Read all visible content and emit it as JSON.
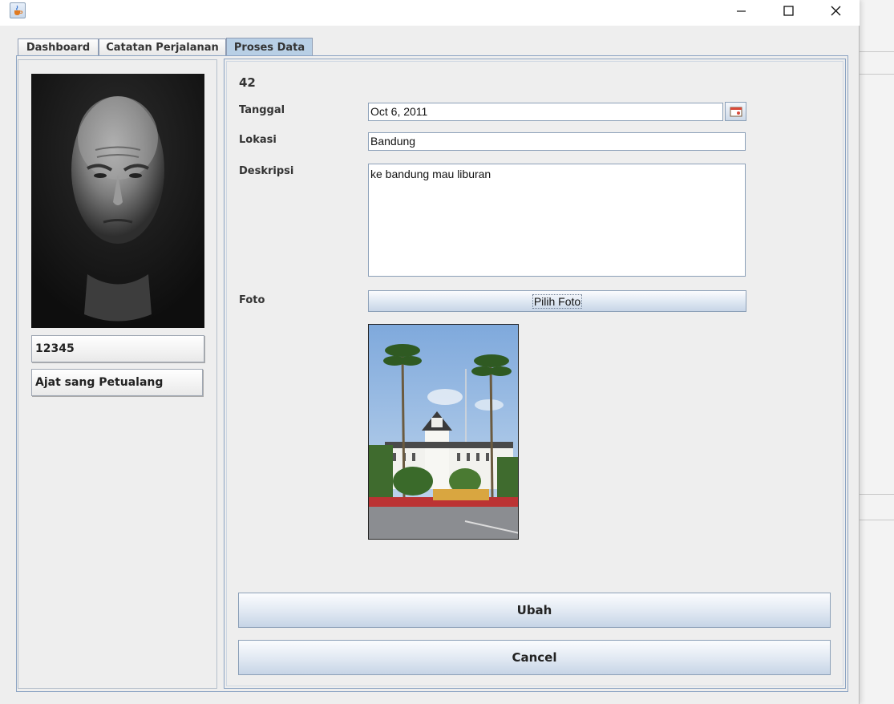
{
  "tabs": [
    {
      "label": "Dashboard",
      "active": false
    },
    {
      "label": "Catatan Perjalanan",
      "active": false
    },
    {
      "label": "Proses Data",
      "active": true
    }
  ],
  "profile": {
    "id_number": "12345",
    "name": "Ajat sang Petualang"
  },
  "form": {
    "record_id": "42",
    "tanggal_label": "Tanggal",
    "tanggal_value": "Oct 6, 2011",
    "lokasi_label": "Lokasi",
    "lokasi_value": "Bandung",
    "deskripsi_label": "Deskripsi",
    "deskripsi_value": "ke bandung mau liburan",
    "foto_label": "Foto",
    "pilih_foto_label": "Pilih Foto"
  },
  "actions": {
    "ubah_label": "Ubah",
    "cancel_label": "Cancel"
  },
  "icons": {
    "app": "java-cup-icon",
    "calendar": "calendar-icon",
    "minimize": "minimize-icon",
    "maximize": "maximize-icon",
    "close": "close-icon"
  },
  "colors": {
    "active_tab": "#b8cfe5",
    "panel_border": "#8ba3c3",
    "window_bg": "#eeeeee"
  }
}
